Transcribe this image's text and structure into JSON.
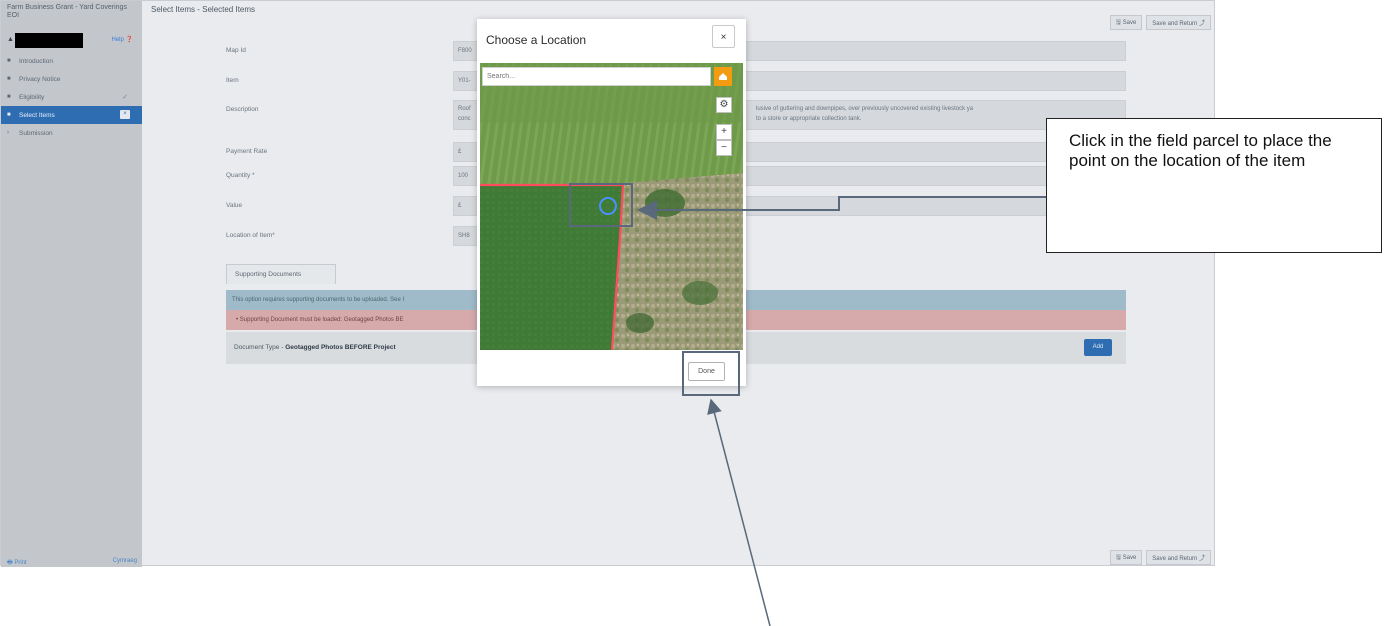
{
  "app": {
    "title": "Farm Business Grant - Yard Coverings EOI",
    "user_marker": "▲",
    "help_label": "Help ❓",
    "page_title": "Select Items - Selected Items"
  },
  "sidebar": {
    "items": [
      {
        "label": "Introduction",
        "icon": "document-icon"
      },
      {
        "label": "Privacy Notice",
        "icon": "document-icon"
      },
      {
        "label": "Eligibility",
        "icon": "document-icon",
        "status": "✓"
      },
      {
        "label": "Select Items",
        "icon": "document-icon",
        "active": true,
        "badge": "×"
      },
      {
        "label": "Submission",
        "icon": "chevron-right-icon"
      }
    ],
    "footer_print": "🖶 Print",
    "footer_right": "Cymraeg"
  },
  "toolbar": {
    "save_label": "🖫 Save",
    "save_return_label": "Save and Return ⤴"
  },
  "form": {
    "map_id_label": "Map Id",
    "map_id_value": "F800",
    "item_label": "Item",
    "item_value": "Y01-",
    "description_label": "Description",
    "description_line1": "Roof",
    "description_line2": "conc",
    "description_right1": "lusive of guttering and downpipes, over previously uncovered existing livestock ya",
    "description_right2": "to a store or appropriate collection tank.",
    "payment_rate_label": "Payment Rate",
    "payment_rate_value": "£",
    "quantity_label": "Quantity *",
    "quantity_value": "100",
    "value_label": "Value",
    "value_value": "£",
    "location_label": "Location of Item*",
    "location_value": "SH8"
  },
  "documents": {
    "tab_label": "Supporting Documents",
    "info_text": "This option requires supporting documents to be uploaded. See I",
    "error_text": "•   Supporting Document must be loaded: Geotagged Photos BE",
    "doc_type_prefix": "Document Type - ",
    "doc_type_value": "Geotagged Photos BEFORE Project",
    "add_label": "Add"
  },
  "modal": {
    "title": "Choose a Location",
    "close": "×",
    "search_placeholder": "Search...",
    "zoom_in": "+",
    "zoom_out": "−",
    "settings_icon": "⚙",
    "done_label": "Done"
  },
  "annotation": {
    "callout_text": "Click in the field parcel to place the point on the location of the item"
  },
  "colors": {
    "accent": "#2f6db3",
    "search_button": "#f39c12",
    "parcel_boundary": "#ff4d5e",
    "marker": "#4a90ff"
  }
}
